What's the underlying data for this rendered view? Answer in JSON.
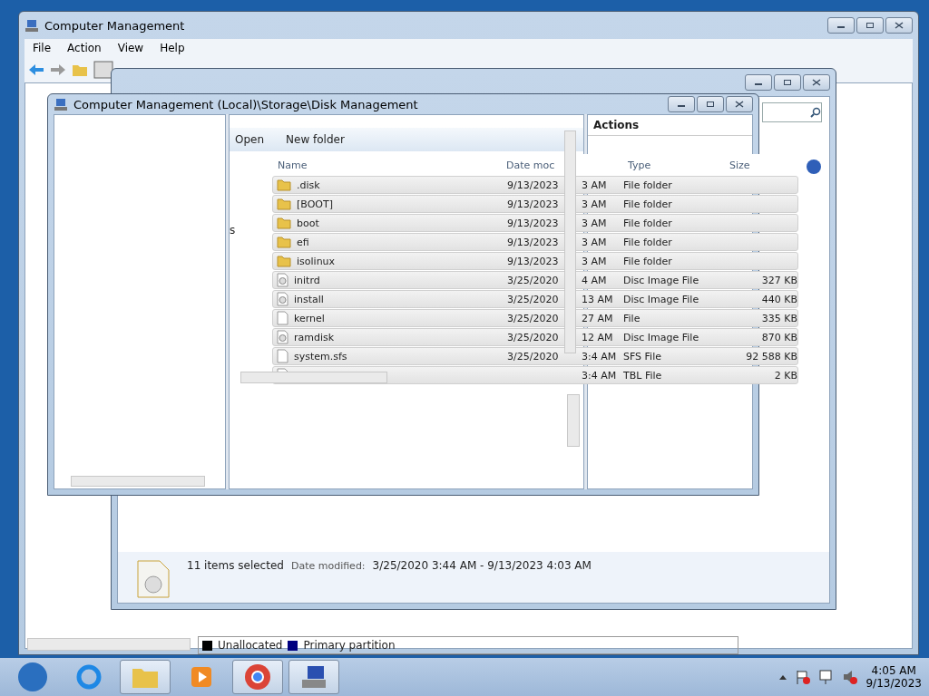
{
  "main_window": {
    "title": "Computer Management",
    "menu": [
      "File",
      "Action",
      "View",
      "Help"
    ],
    "legend": [
      {
        "label": "Unallocated",
        "color": "#000000"
      },
      {
        "label": "Primary partition",
        "color": "#000080"
      }
    ]
  },
  "explorer_window": {
    "details": {
      "count": "11 items selected",
      "label": "Date modified:",
      "value": "3/25/2020 3:44 AM - 9/13/2023 4:03 AM"
    }
  },
  "disk_window": {
    "title": "Computer Management (Local)\\Storage\\Disk Management",
    "toolbar": [
      "Open",
      "New folder"
    ],
    "fragment": "s",
    "actions_header": "Actions"
  },
  "file_list": {
    "columns": [
      "Name",
      "Date moc",
      "Type",
      "Size"
    ],
    "rows": [
      {
        "kind": "folder",
        "selected": true,
        "name": ".disk",
        "date": "9/13/2023",
        "time": "3 AM",
        "type": "File folder"
      },
      {
        "kind": "folder",
        "selected": true,
        "name": "[BOOT]",
        "date": "9/13/2023",
        "time": "3 AM",
        "type": "File folder"
      },
      {
        "kind": "folder",
        "selected": true,
        "name": "boot",
        "date": "9/13/2023",
        "time": "3 AM",
        "type": "File folder"
      },
      {
        "kind": "folder",
        "selected": true,
        "name": "efi",
        "date": "9/13/2023",
        "time": "3 AM",
        "type": "File folder"
      },
      {
        "kind": "folder",
        "selected": true,
        "name": "isolinux",
        "date": "9/13/2023",
        "time": "3 AM",
        "type": "File folder"
      },
      {
        "kind": "disc",
        "selected": true,
        "name": "initrd",
        "date": "3/25/2020",
        "time": "4 AM",
        "type": "Disc Image File",
        "size": "327 KB"
      },
      {
        "kind": "disc",
        "selected": true,
        "name": "install",
        "date": "3/25/2020",
        "time": "13 AM",
        "type": "Disc Image File",
        "size": "440 KB"
      },
      {
        "kind": "file",
        "selected": true,
        "name": "kernel",
        "date": "3/25/2020",
        "time": "27 AM",
        "type": "File",
        "size": "335 KB"
      },
      {
        "kind": "disc",
        "selected": true,
        "name": "ramdisk",
        "date": "3/25/2020",
        "time": "12 AM",
        "type": "Disc Image File",
        "size": "870 KB"
      },
      {
        "kind": "file",
        "selected": true,
        "name": "system.sfs",
        "date": "3/25/2020",
        "time": "3:4 AM",
        "type": "SFS File",
        "size": "92 588 KB"
      },
      {
        "kind": "file",
        "selected": true,
        "time": "3:4 AM",
        "type": "TBL File",
        "size": "2 KB"
      }
    ]
  },
  "taskbar": {
    "clock": {
      "time": "4:05 AM",
      "date": "9/13/2023"
    }
  }
}
